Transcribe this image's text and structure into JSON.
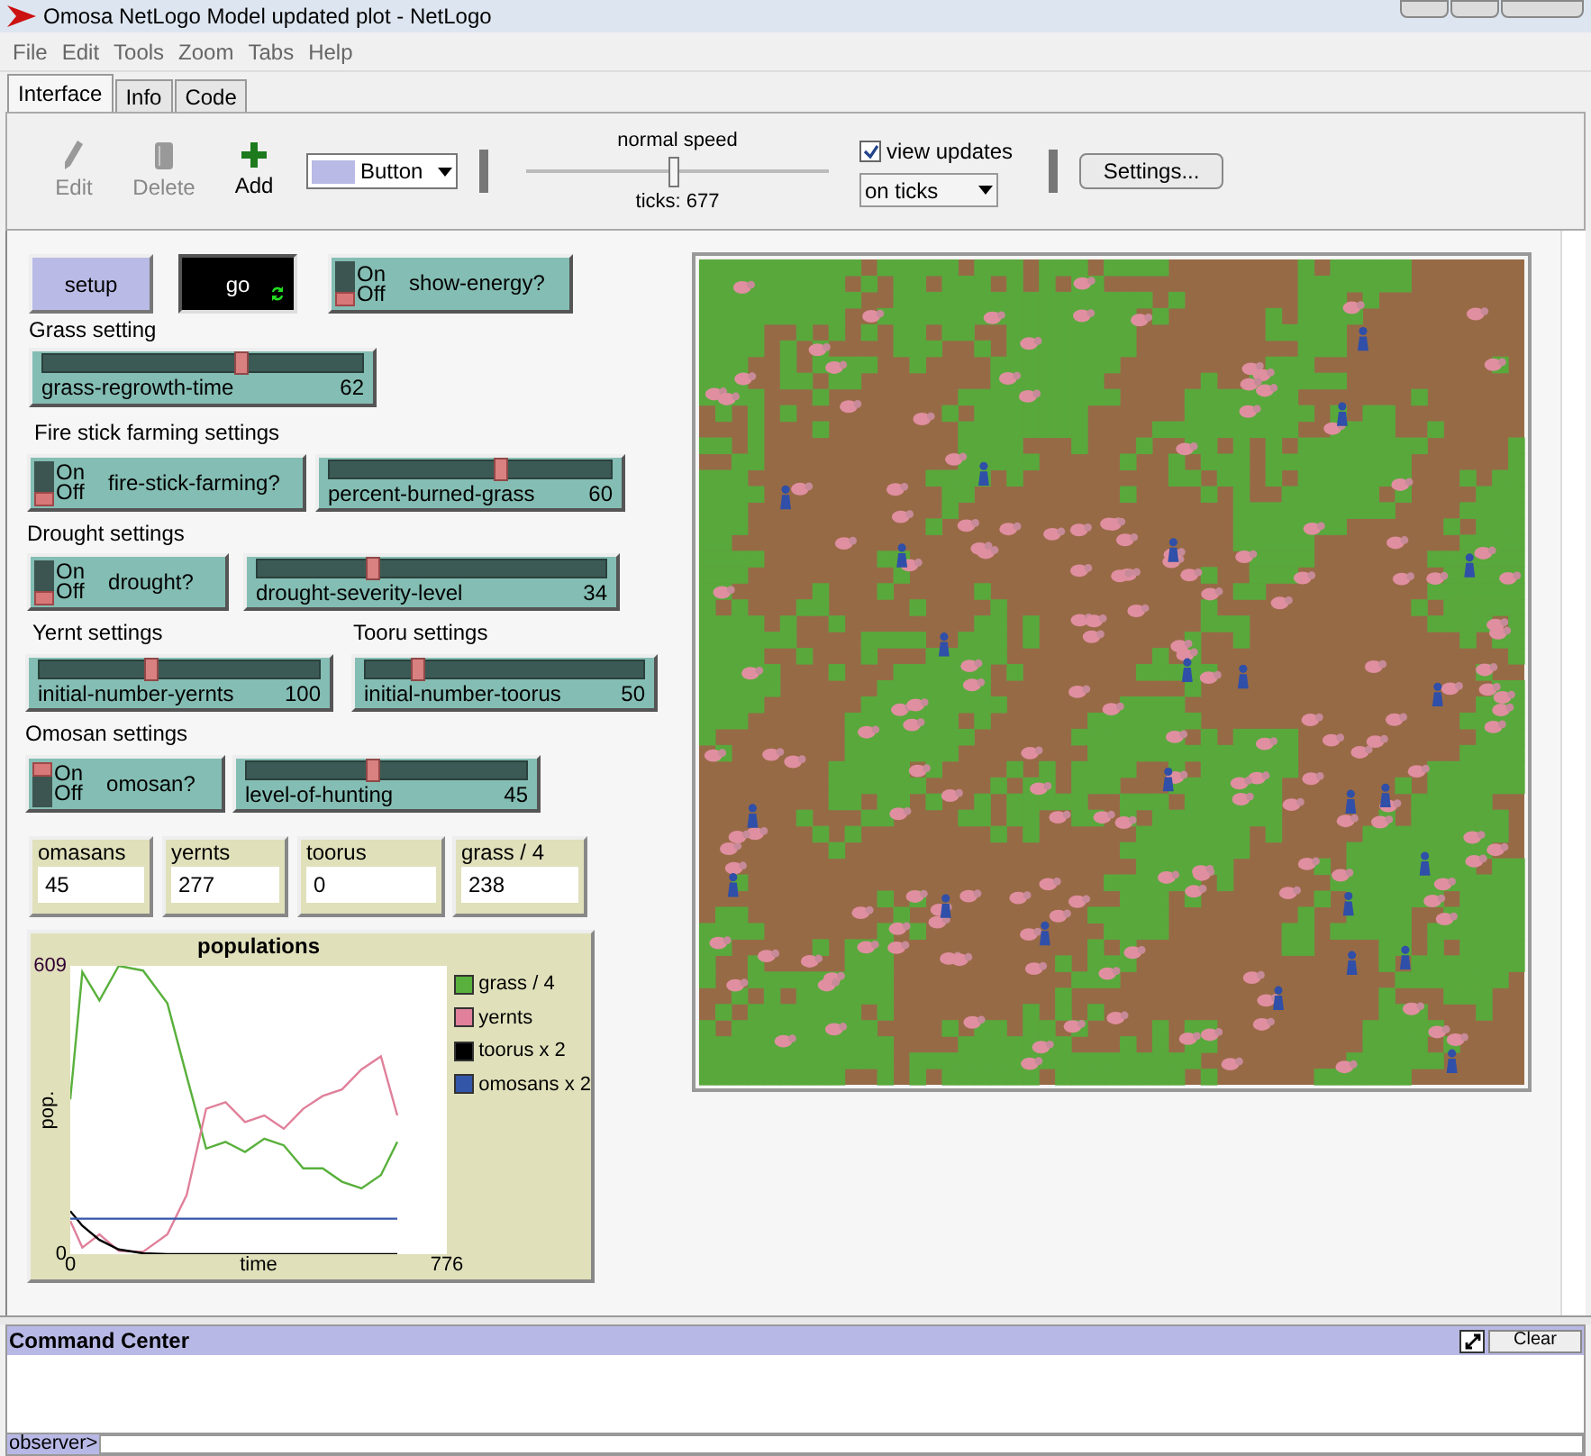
{
  "window": {
    "title": "Omosa NetLogo Model updated plot - NetLogo"
  },
  "menu": [
    "File",
    "Edit",
    "Tools",
    "Zoom",
    "Tabs",
    "Help"
  ],
  "tabs": [
    {
      "label": "Interface",
      "selected": true
    },
    {
      "label": "Info",
      "selected": false
    },
    {
      "label": "Code",
      "selected": false
    }
  ],
  "toolbar": {
    "tools": [
      {
        "kind": "edit",
        "label": "Edit",
        "disabled": true
      },
      {
        "kind": "delete",
        "label": "Delete",
        "disabled": true
      },
      {
        "kind": "add",
        "label": "Add",
        "disabled": false
      }
    ],
    "widget_type": "Button",
    "speed_label": "normal speed",
    "speed": {
      "level": 0.49
    },
    "ticks": "ticks: 677",
    "view_updates": {
      "label": "view updates",
      "checked": true
    },
    "update_mode": "on ticks",
    "settings": "Settings..."
  },
  "widgets": [
    {
      "kind": "button",
      "label": "setup",
      "running": false
    },
    {
      "kind": "button",
      "label": "go",
      "running": true,
      "forever": true
    },
    {
      "kind": "switch",
      "label": "show-energy?",
      "on": false,
      "on_text": "On",
      "off_text": "Off"
    },
    {
      "kind": "label",
      "text": "Grass setting"
    },
    {
      "kind": "slider",
      "label": "grass-regrowth-time",
      "value": "62",
      "level": 0.62
    },
    {
      "kind": "label",
      "text": "Fire stick farming settings"
    },
    {
      "kind": "switch",
      "label": "fire-stick-farming?",
      "on": false,
      "on_text": "On",
      "off_text": "Off"
    },
    {
      "kind": "slider",
      "label": "percent-burned-grass",
      "value": "60",
      "level": 0.61
    },
    {
      "kind": "label",
      "text": "Drought settings"
    },
    {
      "kind": "switch",
      "label": "drought?",
      "on": false,
      "on_text": "On",
      "off_text": "Off"
    },
    {
      "kind": "slider",
      "label": "drought-severity-level",
      "value": "34",
      "level": 0.33
    },
    {
      "kind": "label",
      "text": "Yernt settings"
    },
    {
      "kind": "label",
      "text": "Tooru settings"
    },
    {
      "kind": "slider",
      "label": "initial-number-yernts",
      "value": "100",
      "level": 0.4
    },
    {
      "kind": "slider",
      "label": "initial-number-toorus",
      "value": "50",
      "level": 0.19
    },
    {
      "kind": "label",
      "text": "Omosan settings"
    },
    {
      "kind": "switch",
      "label": "omosan?",
      "on": true,
      "on_text": "On",
      "off_text": "Off"
    },
    {
      "kind": "slider",
      "label": "level-of-hunting",
      "value": "45",
      "level": 0.45
    },
    {
      "kind": "monitor",
      "label": "omasans",
      "value": "45"
    },
    {
      "kind": "monitor",
      "label": "yernts",
      "value": "277"
    },
    {
      "kind": "monitor",
      "label": "toorus",
      "value": "0"
    },
    {
      "kind": "monitor",
      "label": "grass / 4",
      "value": "238"
    },
    {
      "kind": "plot",
      "chart_data": {
        "type": "line",
        "title": "populations",
        "xlabel": "time",
        "ylabel": "pop.",
        "xlim": [
          0,
          776
        ],
        "ylim": [
          0,
          609
        ],
        "xticks": [
          {
            "value": 0,
            "label": "0"
          },
          {
            "value": 776,
            "label": "776"
          }
        ],
        "yticks": [
          {
            "value": 0,
            "label": "0"
          },
          {
            "value": 609,
            "label": "609"
          }
        ],
        "legend": true,
        "x": [
          0,
          25,
          60,
          100,
          150,
          200,
          240,
          280,
          320,
          360,
          400,
          440,
          480,
          520,
          560,
          600,
          640,
          674
        ],
        "series": [
          {
            "name": "grass / 4",
            "color": "#59b03c",
            "values": [
              327,
              596,
              536,
              609,
              599,
              530,
              376,
              223,
              237,
              216,
              244,
              230,
              181,
              181,
              153,
              139,
              167,
              237
            ]
          },
          {
            "name": "yernts",
            "color": "#e0809a",
            "values": [
              70,
              14,
              42,
              7,
              5,
              42,
              125,
              307,
              321,
              279,
              293,
              265,
              307,
              334,
              348,
              390,
              418,
              293
            ]
          },
          {
            "name": "toorus x 2",
            "color": "#000000",
            "values": [
              91,
              60,
              30,
              10,
              2,
              0,
              0,
              0,
              0,
              0,
              0,
              0,
              0,
              0,
              0,
              0,
              0,
              0
            ]
          },
          {
            "name": "omosans x 2",
            "color": "#3456a8",
            "values": [
              75,
              75,
              75,
              75,
              75,
              75,
              75,
              75,
              75,
              75,
              75,
              75,
              75,
              75,
              75,
              75,
              75,
              75
            ]
          }
        ]
      }
    }
  ],
  "command_center": {
    "title": "Command Center",
    "clear": "Clear",
    "prompt": "observer>"
  }
}
